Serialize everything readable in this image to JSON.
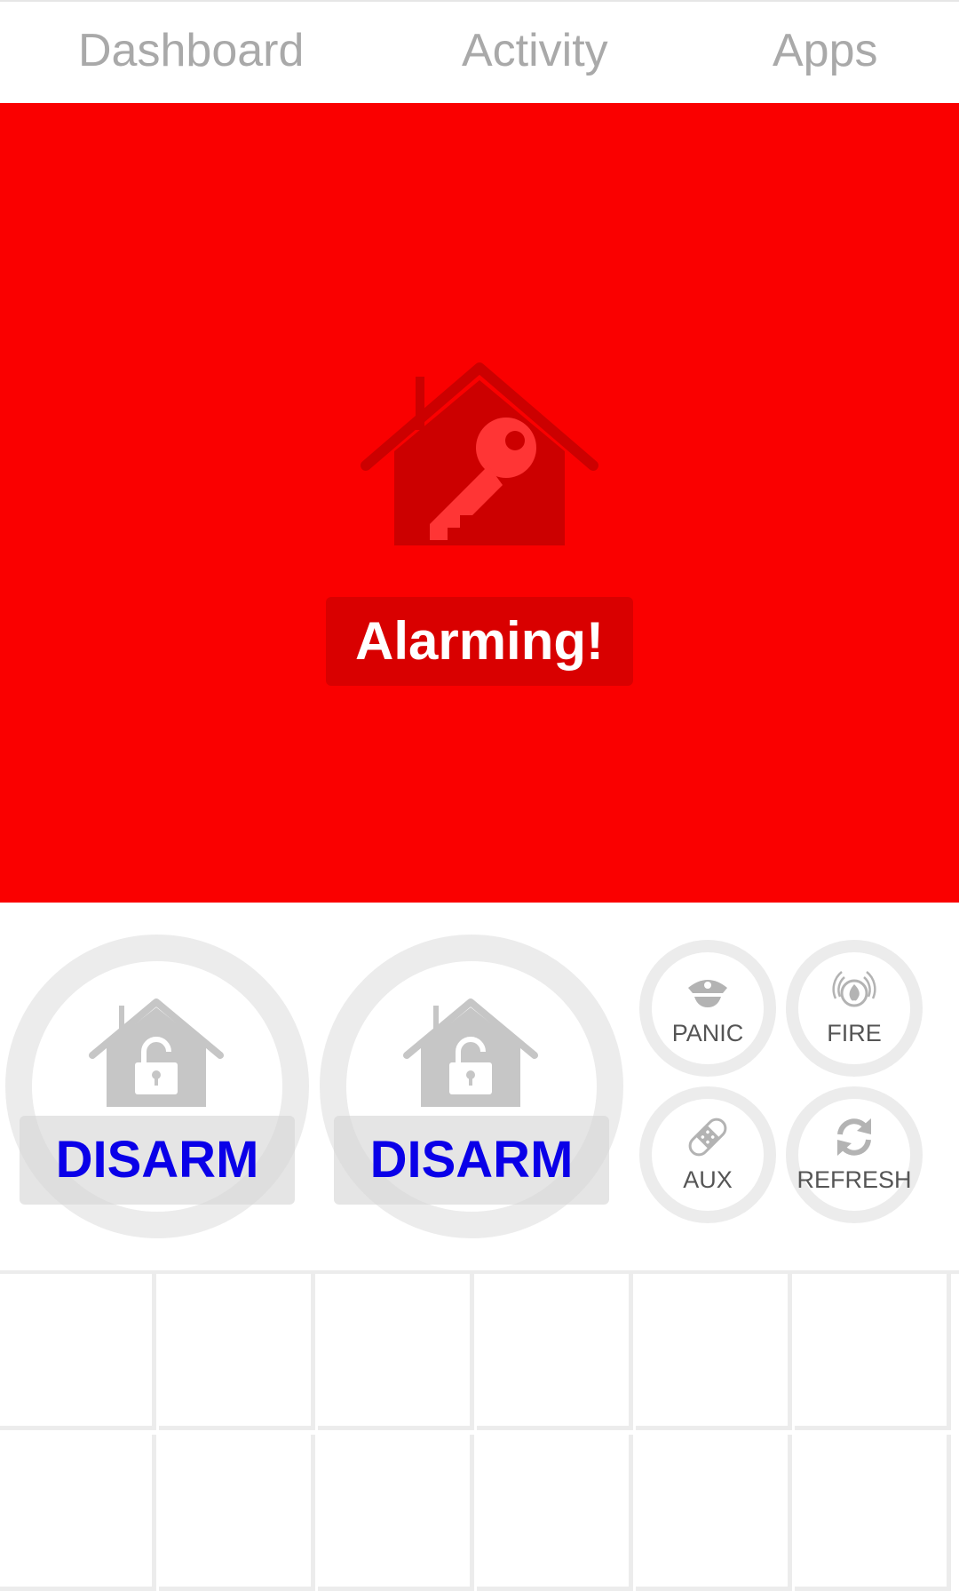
{
  "nav": {
    "tabs": [
      {
        "label": "Dashboard"
      },
      {
        "label": "Activity"
      },
      {
        "label": "Apps"
      }
    ]
  },
  "alarm": {
    "status_text": "Alarming!",
    "background_color": "#fa0000",
    "icon": "house-key-icon"
  },
  "controls": {
    "disarm_buttons": [
      {
        "label": "DISARM",
        "icon": "house-unlocked-icon"
      },
      {
        "label": "DISARM",
        "icon": "house-unlocked-icon"
      }
    ],
    "actions": [
      {
        "label": "PANIC",
        "icon": "police-cap-icon"
      },
      {
        "label": "FIRE",
        "icon": "fire-alarm-icon"
      },
      {
        "label": "AUX",
        "icon": "bandage-icon"
      },
      {
        "label": "REFRESH",
        "icon": "refresh-icon"
      }
    ],
    "label_color": "#0a00e8"
  }
}
